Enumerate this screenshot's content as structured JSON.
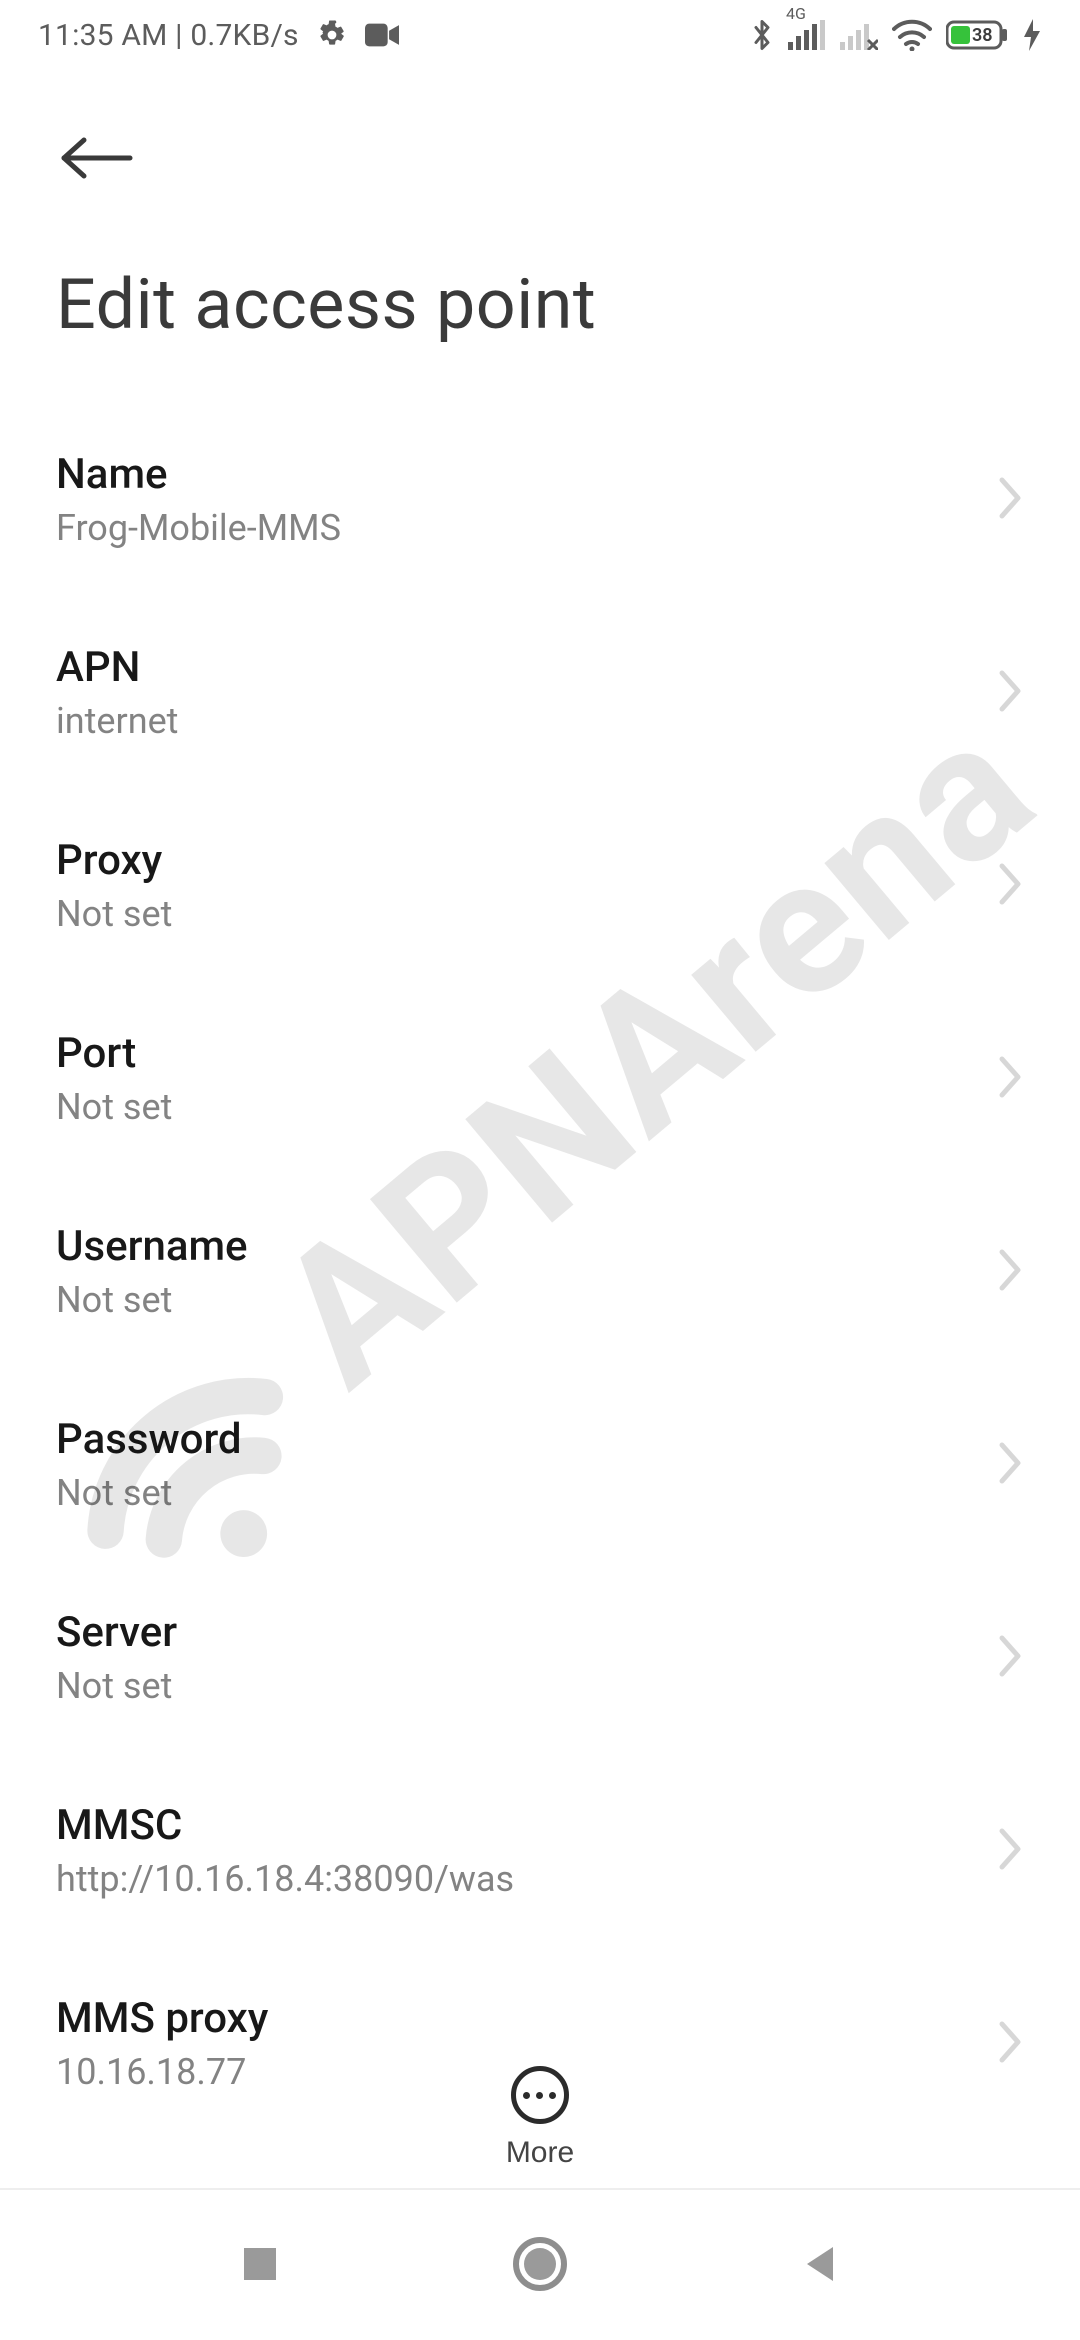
{
  "status_bar": {
    "time": "11:35 AM",
    "net_speed": "0.7KB/s",
    "battery_percent": "38",
    "signal_label": "4G"
  },
  "header": {
    "page_title": "Edit access point"
  },
  "settings": [
    {
      "key": "name",
      "label": "Name",
      "value": "Frog-Mobile-MMS"
    },
    {
      "key": "apn",
      "label": "APN",
      "value": "internet"
    },
    {
      "key": "proxy",
      "label": "Proxy",
      "value": "Not set"
    },
    {
      "key": "port",
      "label": "Port",
      "value": "Not set"
    },
    {
      "key": "username",
      "label": "Username",
      "value": "Not set"
    },
    {
      "key": "password",
      "label": "Password",
      "value": "Not set"
    },
    {
      "key": "server",
      "label": "Server",
      "value": "Not set"
    },
    {
      "key": "mmsc",
      "label": "MMSC",
      "value": "http://10.16.18.4:38090/was"
    },
    {
      "key": "mms_proxy",
      "label": "MMS proxy",
      "value": "10.16.18.77"
    }
  ],
  "footer": {
    "more_label": "More"
  },
  "watermark": {
    "text": "APNArena"
  }
}
